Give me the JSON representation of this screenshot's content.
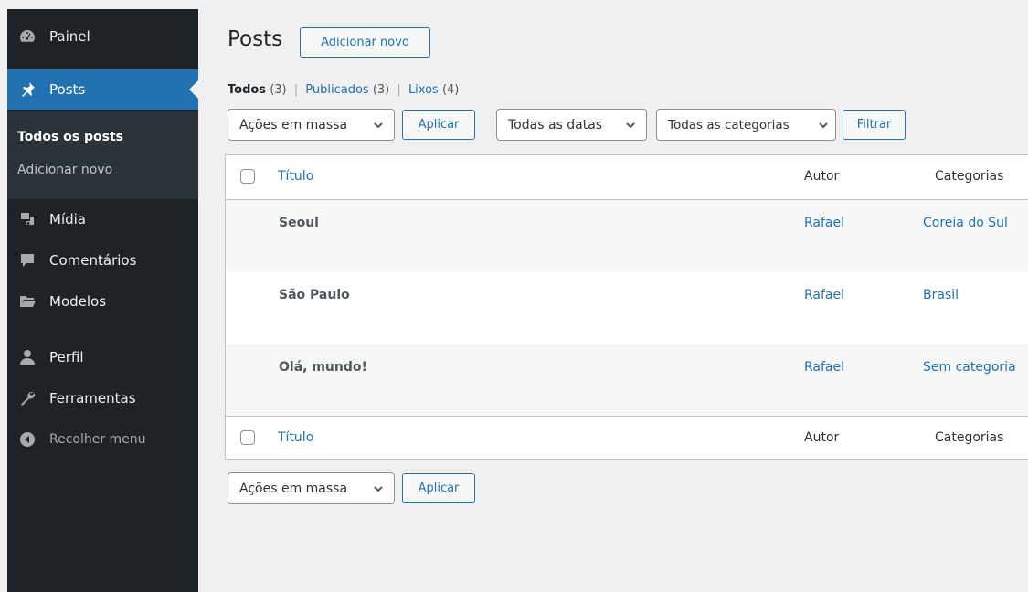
{
  "sidebar": {
    "items": [
      {
        "label": "Painel",
        "icon": "dashboard-icon"
      },
      {
        "label": "Posts",
        "icon": "pin-icon"
      },
      {
        "label": "Mídia",
        "icon": "media-icon"
      },
      {
        "label": "Comentários",
        "icon": "comment-icon"
      },
      {
        "label": "Modelos",
        "icon": "folder-icon"
      },
      {
        "label": "Perfil",
        "icon": "user-icon"
      },
      {
        "label": "Ferramentas",
        "icon": "wrench-icon"
      },
      {
        "label": "Recolher menu",
        "icon": "collapse-icon"
      }
    ],
    "submenu": [
      "Todos os posts",
      "Adicionar novo"
    ]
  },
  "header": {
    "title": "Posts",
    "add_new": "Adicionar novo"
  },
  "filters": {
    "links": [
      {
        "label": "Todos",
        "count": "(3)"
      },
      {
        "label": "Publicados",
        "count": "(3)"
      },
      {
        "label": "Lixos",
        "count": "(4)"
      }
    ],
    "bulk_actions": "Ações em massa",
    "apply": "Aplicar",
    "dates": "Todas as datas",
    "categories": "Todas as categorias",
    "filter": "Filtrar"
  },
  "table": {
    "columns": {
      "title": "Título",
      "author": "Autor",
      "categories": "Categorias"
    },
    "rows": [
      {
        "title": "Seoul",
        "author": "Rafael",
        "category": "Coreia do Sul"
      },
      {
        "title": "São Paulo",
        "author": "Rafael",
        "category": "Brasil"
      },
      {
        "title": "Olá, mundo!",
        "author": "Rafael",
        "category": "Sem categoria"
      }
    ]
  },
  "colors": {
    "accent": "#2271b1",
    "sidebar_bg": "#1d2327",
    "page_bg": "#f0f0f1"
  }
}
